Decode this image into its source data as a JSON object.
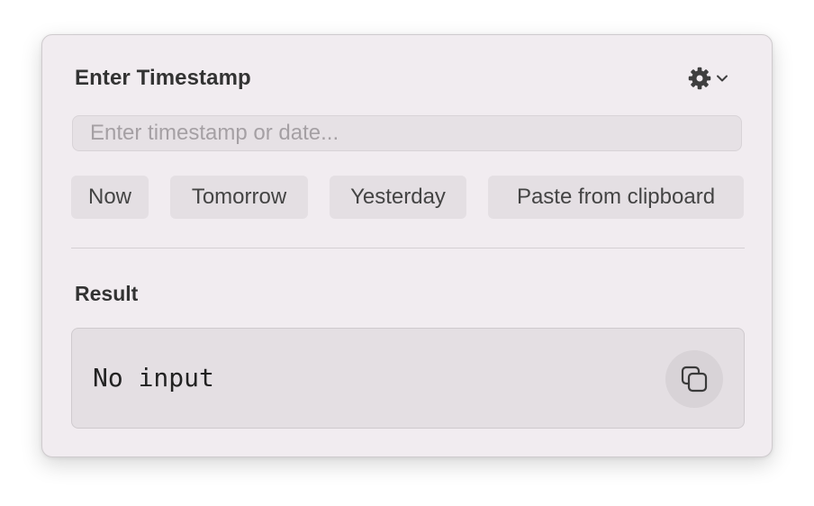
{
  "panel": {
    "title": "Enter Timestamp",
    "settings_icon": "gear-icon",
    "settings_menu_icon": "chevron-down-icon"
  },
  "input": {
    "placeholder": "Enter timestamp or date...",
    "value": ""
  },
  "quick_buttons": [
    {
      "label": "Now"
    },
    {
      "label": "Tomorrow"
    },
    {
      "label": "Yesterday"
    },
    {
      "label": "Paste from clipboard"
    }
  ],
  "result": {
    "label": "Result",
    "value": "No input",
    "copy_icon": "copy-icon"
  },
  "colors": {
    "panel_background": "#f1ecf0",
    "control_background": "#e4dfe3",
    "text": "#333333"
  }
}
